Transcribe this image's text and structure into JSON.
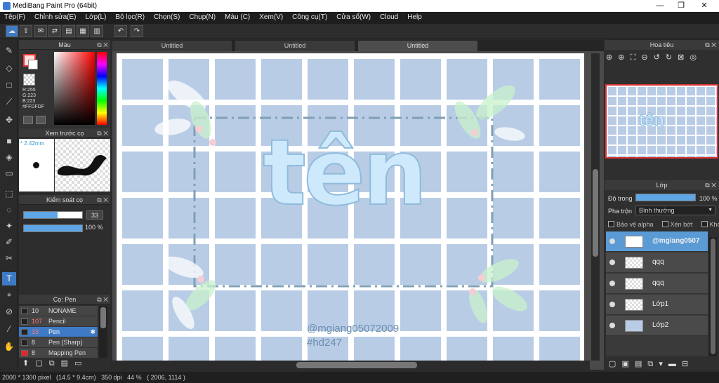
{
  "window": {
    "title": "MediBang Paint Pro (64bit)",
    "minimize": "—",
    "restore": "❐",
    "close": "✕"
  },
  "menu": [
    "Tệp(F)",
    "Chỉnh sửa(E)",
    "Lớp(L)",
    "Bộ lọc(R)",
    "Chọn(S)",
    "Chụp(N)",
    "Màu (C)",
    "Xem(V)",
    "Công cụ(T)",
    "Cửa sổ(W)",
    "Cloud",
    "Help"
  ],
  "tabs": [
    "Untitled",
    "Untitled",
    "Untitled"
  ],
  "color_panel": {
    "title": "Màu",
    "r": "R:255",
    "g": "G:223",
    "b": "B:223",
    "hex": "#FFDFDF",
    "primary_color": "#FFDFDF"
  },
  "preview_panel": {
    "title": "Xem trước cọ",
    "size": "* 2.42mm"
  },
  "brush_control": {
    "title": "Kiểm soát cọ",
    "size_value": "33",
    "opacity_value": "100 %"
  },
  "brush_panel": {
    "title": "Cọ: Pen",
    "items": [
      {
        "size": "10",
        "name": "NONAME"
      },
      {
        "size": "107",
        "name": "Pencil"
      },
      {
        "size": "33",
        "name": "Pen"
      },
      {
        "size": "8",
        "name": "Pen (Sharp)"
      },
      {
        "size": "8",
        "name": "Mapping Pen"
      }
    ]
  },
  "navigator": {
    "title": "Hoa tiêu"
  },
  "layer_panel": {
    "title": "Lớp",
    "opacity_label": "Độ trong",
    "opacity_value": "100 %",
    "blend_label": "Pha trộn",
    "blend_value": "Bình thường",
    "protect_alpha": "Bảo vệ alpha",
    "clip": "Xén bớt",
    "lock": "Khóa",
    "layers": [
      "@mgiang0507",
      "qqq",
      "qqq",
      "Lớp1",
      "Lớp2"
    ]
  },
  "artwork": {
    "main_text": "tên",
    "credit": "@mgiang05072009",
    "tag": "#hd247"
  },
  "status": "2000 * 1300 pixel   (14.5 * 9.4cm)   350 dpi   44 %   ( 2006, 1114 )"
}
